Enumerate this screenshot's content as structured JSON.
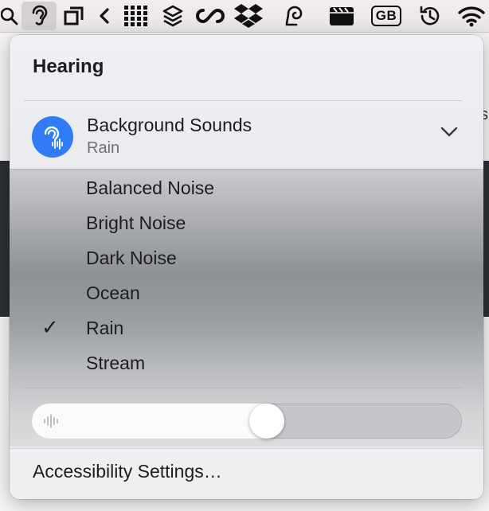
{
  "background": {
    "fragment_char": "s"
  },
  "menubar": {
    "icons": [
      "search-icon",
      "hearing-icon",
      "screen-mirror-icon",
      "chevron-left-icon",
      "grid-icon",
      "layers-icon",
      "infinity-icon",
      "dropbox-icon",
      "ear-swirl-icon",
      "clapper-icon",
      "input-source-icon",
      "time-machine-icon",
      "wifi-icon"
    ],
    "input_source_label": "GB"
  },
  "popover": {
    "title": "Hearing",
    "background_sounds": {
      "title": "Background Sounds",
      "subtitle": "Rain",
      "icon": "hearing-waveform-icon",
      "accent_color": "#2f7cf6"
    },
    "options": [
      {
        "label": "Balanced Noise",
        "selected": false
      },
      {
        "label": "Bright Noise",
        "selected": false
      },
      {
        "label": "Dark Noise",
        "selected": false
      },
      {
        "label": "Ocean",
        "selected": false
      },
      {
        "label": "Rain",
        "selected": true
      },
      {
        "label": "Stream",
        "selected": false
      }
    ],
    "check_mark": "✓",
    "volume": {
      "level": 0.55,
      "icon": "waveform-icon"
    },
    "footer_label": "Accessibility Settings…"
  }
}
